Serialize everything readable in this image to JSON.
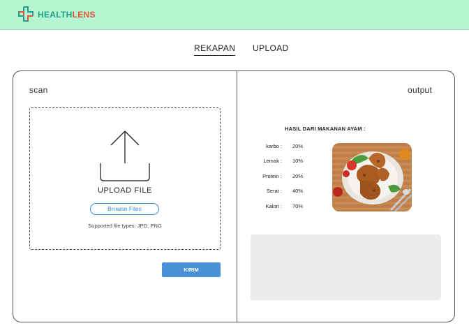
{
  "header": {
    "logo_part1": "HEALTH",
    "logo_part2": "LENS",
    "brand_colors": {
      "header_bg": "#b6f5d2",
      "teal": "#1f9e8c",
      "red": "#e2533b"
    }
  },
  "tabs": [
    {
      "label": "REKAPAN",
      "active": true
    },
    {
      "label": "UPLOAD",
      "active": false
    }
  ],
  "scan": {
    "label": "scan",
    "upload_title": "UPLOAD FILE",
    "browse_label": "Browse Files",
    "supported_text": "Supported file types: JPG, PNG",
    "submit_label": "KIRIM",
    "icon": "upload-icon"
  },
  "output": {
    "label": "output",
    "result_title": "HASIL DARI MAKANAN AYAM :",
    "nutrients": [
      {
        "label": "karbo :",
        "value": "20%"
      },
      {
        "label": "Lemak :",
        "value": "10%"
      },
      {
        "label": "Protein :",
        "value": "20%"
      },
      {
        "label": "Serat :",
        "value": "40%"
      },
      {
        "label": "Kalori :",
        "value": "70%"
      }
    ],
    "image": "fried-chicken-photo"
  }
}
